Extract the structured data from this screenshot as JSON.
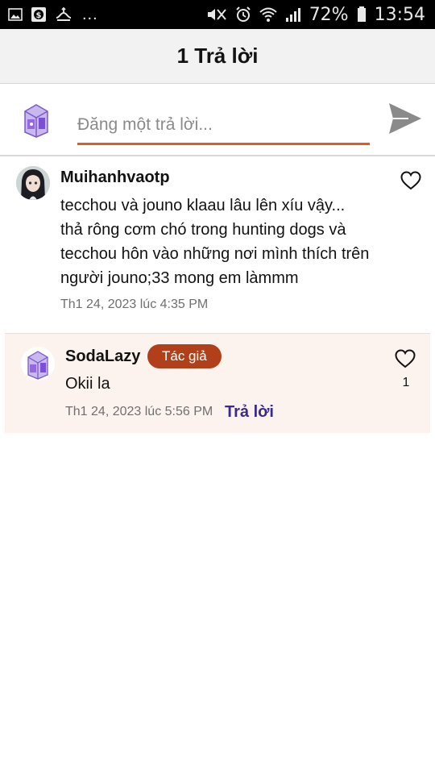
{
  "status_bar": {
    "battery_percent": "72%",
    "time": "13:54",
    "overflow": "...",
    "icons": [
      "gallery-icon",
      "dollar-icon",
      "usb-icon",
      "mute-icon",
      "alarm-icon",
      "wifi-icon",
      "signal-icon",
      "battery-icon"
    ]
  },
  "header": {
    "title": "1 Trả lời"
  },
  "composer": {
    "placeholder": "Đăng một trả lời...",
    "accent_color": "#e35b21",
    "send_icon": "send-icon"
  },
  "comment": {
    "username": "Muihanhvaotp",
    "text": "tecchou và jouno klaau lâu lên xíu vậy...\nthả rông cơm chó trong hunting dogs và\ntecchou hôn vào những nơi mình thích trên\nngười jouno;33 mong em làmmm",
    "timestamp": "Th1 24, 2023 lúc 4:35 PM",
    "like_icon": "heart-outline-icon"
  },
  "reply": {
    "username": "SodaLazy",
    "badge": "Tác giả",
    "badge_color": "#b1401a",
    "text": "Okii la",
    "timestamp": "Th1 24, 2023 lúc 5:56 PM",
    "reply_label": "Trả lời",
    "like_count": "1",
    "like_icon": "heart-outline-icon"
  }
}
